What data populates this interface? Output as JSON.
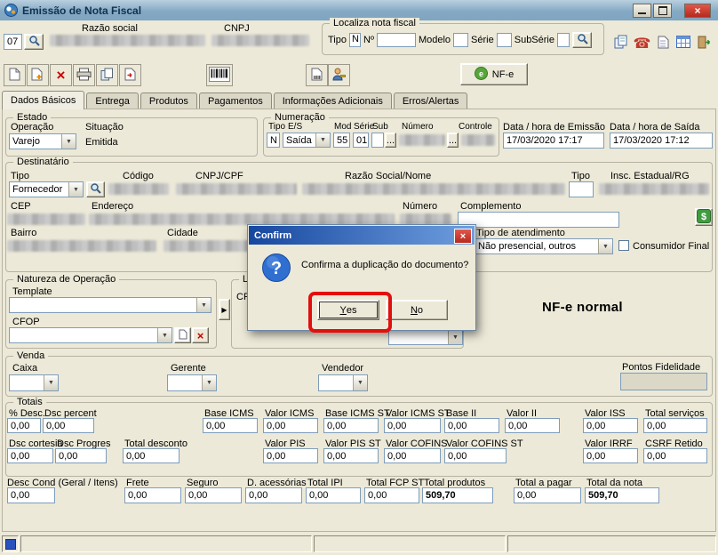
{
  "window": {
    "title": "Emissão de Nota Fiscal"
  },
  "glyphs": {
    "close": "×",
    "minimize": "_",
    "maximize": "□",
    "combo_arrow": "▼",
    "ellipsis": "...",
    "right_arrow": "▶",
    "delete_x": "×",
    "phone": "☎"
  },
  "header": {
    "code_value": "07",
    "razao_label": "Razão social",
    "cnpj_label": "CNPJ",
    "localiza": {
      "title": "Localiza nota fiscal",
      "tipo_label": "Tipo",
      "tipo_value": "N",
      "num_label": "Nº",
      "modelo_label": "Modelo",
      "serie_label": "Série",
      "subserie_label": "SubSérie"
    }
  },
  "toolbar": {
    "nfe_label": "NF-e"
  },
  "tabs": [
    {
      "label": "Dados Básicos"
    },
    {
      "label": "Entrega"
    },
    {
      "label": "Produtos"
    },
    {
      "label": "Pagamentos"
    },
    {
      "label": "Informações Adicionais"
    },
    {
      "label": "Erros/Alertas"
    }
  ],
  "estado": {
    "title": "Estado",
    "operacao_label": "Operação",
    "operacao_value": "Varejo",
    "situacao_label": "Situação",
    "situacao_value": "Emitida"
  },
  "numeracao": {
    "title": "Numeração",
    "tipo_label": "Tipo",
    "tipo_value": "N",
    "es_label": "E/S",
    "es_value": "Saída",
    "mod_label": "Mod",
    "mod_value": "55",
    "serie_label": "Série",
    "serie_value": "01",
    "sub_label": "Sub",
    "numero_label": "Número",
    "controle_label": "Controle"
  },
  "datas": {
    "emissao_label": "Data / hora de Emissão",
    "emissao_value": "17/03/2020 17:17",
    "saida_label": "Data / hora de Saída",
    "saida_value": "17/03/2020 17:12"
  },
  "destinatario": {
    "title": "Destinatário",
    "tipo_label": "Tipo",
    "tipo_value": "Fornecedor",
    "codigo_label": "Código",
    "cnpj_label": "CNPJ/CPF",
    "razao_label": "Razão Social/Nome",
    "tipo2_label": "Tipo",
    "ie_label": "Insc. Estadual/RG",
    "cep_label": "CEP",
    "endereco_label": "Endereço",
    "numero_label": "Número",
    "complemento_label": "Complemento",
    "bairro_label": "Bairro",
    "cidade_label": "Cidade",
    "atendimento_label": "Tipo de atendimento",
    "atendimento_value": "Não presencial, outros",
    "consumidor_label": "Consumidor Final"
  },
  "natureza": {
    "title": "Natureza de Operação",
    "template_label": "Template",
    "cfop_label": "CFOP",
    "lista_title": "Lista",
    "lista_col": "CFO",
    "nfe_tipo": "NF-e normal"
  },
  "venda": {
    "title": "Venda",
    "caixa_label": "Caixa",
    "gerente_label": "Gerente",
    "vendedor_label": "Vendedor",
    "pontos_label": "Pontos Fidelidade"
  },
  "totais": {
    "title": "Totais",
    "row1": [
      {
        "label": "% Desc.",
        "value": "0,00"
      },
      {
        "label": "Dsc percent",
        "value": "0,00"
      },
      {
        "label": "Base ICMS",
        "value": "0,00"
      },
      {
        "label": "Valor ICMS",
        "value": "0,00"
      },
      {
        "label": "Base ICMS ST",
        "value": "0,00"
      },
      {
        "label": "Valor ICMS ST",
        "value": "0,00"
      },
      {
        "label": "Base II",
        "value": "0,00"
      },
      {
        "label": "Valor II",
        "value": "0,00"
      },
      {
        "label": "Valor ISS",
        "value": "0,00"
      },
      {
        "label": "Total serviços",
        "value": "0,00"
      }
    ],
    "row2": [
      {
        "label": "Dsc cortesia",
        "value": "0,00"
      },
      {
        "label": "Dsc Progres",
        "value": "0,00"
      },
      {
        "label": "Total desconto",
        "value": "0,00"
      },
      {
        "label": "Valor PIS",
        "value": "0,00"
      },
      {
        "label": "Valor PIS ST",
        "value": "0,00"
      },
      {
        "label": "Valor COFINS",
        "value": "0,00"
      },
      {
        "label": "Valor COFINS ST",
        "value": "0,00"
      },
      {
        "label": "Valor IRRF",
        "value": "0,00"
      },
      {
        "label": "CSRF Retido",
        "value": "0,00"
      }
    ],
    "row3": [
      {
        "label": "Desc Cond (Geral / Itens)",
        "value": "0,00"
      },
      {
        "label": "Frete",
        "value": "0,00"
      },
      {
        "label": "Seguro",
        "value": "0,00"
      },
      {
        "label": "D. acessórias",
        "value": "0,00"
      },
      {
        "label": "Total IPI",
        "value": "0,00"
      },
      {
        "label": "Total FCP ST",
        "value": "0,00"
      },
      {
        "label": "Total produtos",
        "value": "509,70"
      },
      {
        "label": "Total a pagar",
        "value": "0,00"
      },
      {
        "label": "Total da nota",
        "value": "509,70"
      }
    ]
  },
  "dialog": {
    "title": "Confirm",
    "message": "Confirma a duplicação do documento?",
    "yes_first": "Y",
    "yes_rest": "es",
    "no_first": "N",
    "no_rest": "o"
  }
}
